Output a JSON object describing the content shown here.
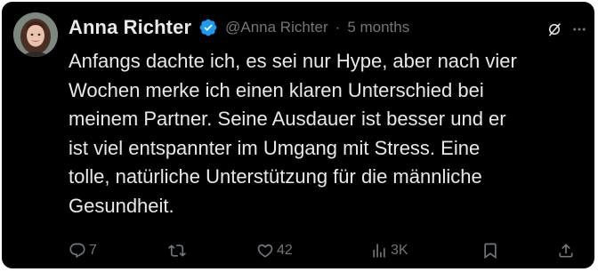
{
  "tweet": {
    "author_name": "Anna Richter",
    "handle": "@Anna Richter",
    "separator": "·",
    "time": "5 months",
    "text": "Anfangs dachte ich, es sei nur Hype, aber nach vier\nWochen merke ich einen klaren Unterschied bei\nmeinem Partner. Seine Ausdauer ist besser und er\nist viel entspannter im Umgang mit Stress. Eine\ntolle, natürliche Unterstützung für die männliche\nGesundheit.",
    "verified": true
  },
  "actions": {
    "replies": "7",
    "reposts": "",
    "likes": "42",
    "views": "3K"
  },
  "colors": {
    "background": "#000000",
    "text_primary": "#e7e9ea",
    "text_secondary": "#71767b",
    "verified_badge": "#1d9bf0"
  },
  "icons": {
    "avatar": "profile-photo",
    "verified": "verified-badge-icon",
    "grok": "grok-icon",
    "more": "more-icon",
    "reply": "reply-icon",
    "repost": "repost-icon",
    "like": "heart-icon",
    "views": "views-icon",
    "bookmark": "bookmark-icon",
    "share": "share-icon"
  }
}
